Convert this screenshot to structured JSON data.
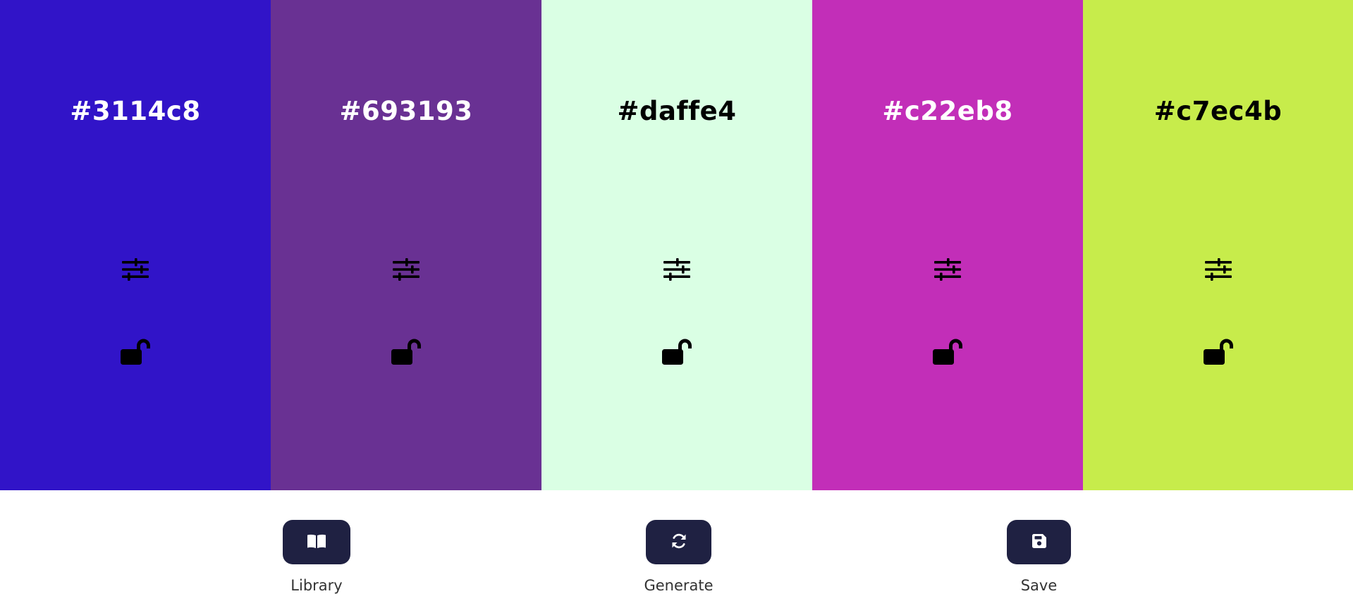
{
  "palette": [
    {
      "hex": "#3114c8",
      "label": "#3114c8",
      "text_color": "#ffffff",
      "adjust_icon": "sliders-icon",
      "lock_icon": "unlock-icon"
    },
    {
      "hex": "#693193",
      "label": "#693193",
      "text_color": "#ffffff",
      "adjust_icon": "sliders-icon",
      "lock_icon": "unlock-icon"
    },
    {
      "hex": "#daffe4",
      "label": "#daffe4",
      "text_color": "#000000",
      "adjust_icon": "sliders-icon",
      "lock_icon": "unlock-icon"
    },
    {
      "hex": "#c22eb8",
      "label": "#c22eb8",
      "text_color": "#ffffff",
      "adjust_icon": "sliders-icon",
      "lock_icon": "unlock-icon"
    },
    {
      "hex": "#c7ec4b",
      "label": "#c7ec4b",
      "text_color": "#000000",
      "adjust_icon": "sliders-icon",
      "lock_icon": "unlock-icon"
    }
  ],
  "panel": {
    "button_color": "#1f2142",
    "library": {
      "label": "Library",
      "icon": "book-open-icon"
    },
    "generate": {
      "label": "Generate",
      "icon": "refresh-icon"
    },
    "save": {
      "label": "Save",
      "icon": "save-icon"
    }
  }
}
